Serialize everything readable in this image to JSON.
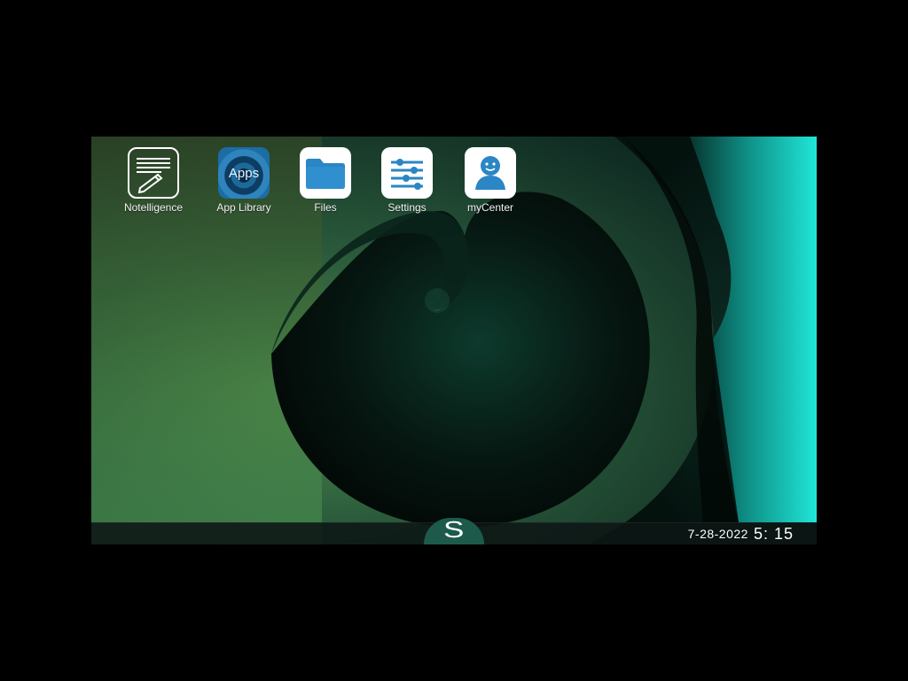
{
  "desktop": {
    "apps": [
      {
        "label": "Notelligence",
        "icon": "notepad-icon"
      },
      {
        "label": "App Library",
        "icon": "apps-icon",
        "icon_text": "Apps"
      },
      {
        "label": "Files",
        "icon": "folder-icon"
      },
      {
        "label": "Settings",
        "icon": "sliders-icon"
      },
      {
        "label": "myCenter",
        "icon": "person-icon"
      }
    ]
  },
  "taskbar": {
    "start_label": "S",
    "date": "7-28-2022",
    "time": "5: 15"
  },
  "colors": {
    "accent_blue": "#2a86c4",
    "taskbar": "#0c1614",
    "start_button": "#1d5a4c",
    "wallpaper_cyan": "#1fe6d8",
    "wallpaper_green": "#4d8a4c"
  }
}
